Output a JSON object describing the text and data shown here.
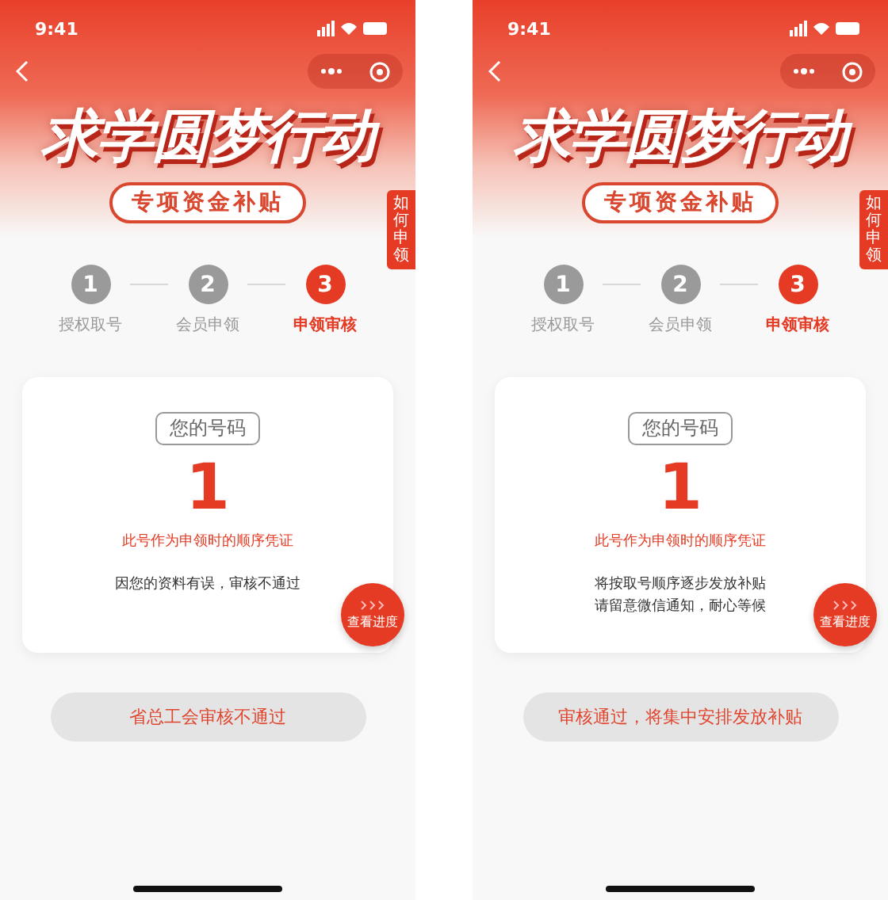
{
  "screens": [
    {
      "status_bar": {
        "time": "9:41"
      },
      "title": "求学圆梦行动",
      "subtitle": "专项资金补贴",
      "side_tab": "如何申领",
      "steps": [
        {
          "number": "1",
          "label": "授权取号",
          "selected": false
        },
        {
          "number": "2",
          "label": "会员申领",
          "selected": false
        },
        {
          "number": "3",
          "label": "申领审核",
          "selected": true
        }
      ],
      "card": {
        "chip": "您的号码",
        "number": "1",
        "caption": "此号作为申领时的顺序凭证",
        "message_lines": [
          "因您的资料有误，审核不通过"
        ]
      },
      "progress_button": {
        "label": "查看进度"
      },
      "result_button": {
        "label": "省总工会审核不通过"
      }
    },
    {
      "status_bar": {
        "time": "9:41"
      },
      "title": "求学圆梦行动",
      "subtitle": "专项资金补贴",
      "side_tab": "如何申领",
      "steps": [
        {
          "number": "1",
          "label": "授权取号",
          "selected": false
        },
        {
          "number": "2",
          "label": "会员申领",
          "selected": false
        },
        {
          "number": "3",
          "label": "申领审核",
          "selected": true
        }
      ],
      "card": {
        "chip": "您的号码",
        "number": "1",
        "caption": "此号作为申领时的顺序凭证",
        "message_lines": [
          "将按取号顺序逐步发放补贴",
          "请留意微信通知，耐心等候"
        ]
      },
      "progress_button": {
        "label": "查看进度"
      },
      "result_button": {
        "label": "审核通过，将集中安排发放补贴"
      }
    }
  ]
}
